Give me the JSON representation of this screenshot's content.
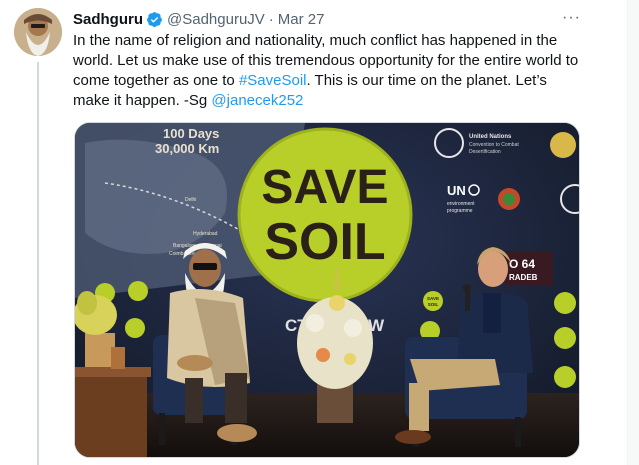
{
  "tweet": {
    "author_name": "Sadhguru",
    "author_handle": "@SadhguruJV",
    "separator": "·",
    "date": "Mar 27",
    "more_label": "···",
    "text_parts": {
      "p1": "In the name of religion and nationality, much conflict has happened in the world. Let us make use of this tremendous opportunity for the entire world to come together as one to ",
      "hashtag": "#SaveSoil",
      "p2": ". This is our time on the planet. Let’s make it happen. -Sg ",
      "mention": "@janecek252"
    }
  },
  "media": {
    "sign_line1": "SAVE",
    "sign_line2": "SOIL",
    "banner_line1": "100 Days",
    "banner_line2": "30,000 Km",
    "map_cities": [
      "Bangalore",
      "Chennai",
      "Hyderabad",
      "Coimbatore",
      "Delhi"
    ],
    "un_label_line1": "United Nations",
    "un_label_line2": "Convention to Combat",
    "un_label_line3": "Desertification",
    "unep_label": "UN",
    "unep_sub1": "environment",
    "unep_sub2": "programme",
    "badge_text_1": "SAVE",
    "badge_text_2": "SOIL",
    "screen_text_1": "O 64",
    "screen_text_2": "RADEB",
    "stage_text": "CTION NOW",
    "brand_colors": {
      "sign_green": "#b8cf2a",
      "link_blue": "#1d9bf0",
      "stage_blue": "#1b2a4a"
    },
    "icons": [
      "verified-badge-icon",
      "more-horizontal-icon"
    ]
  }
}
